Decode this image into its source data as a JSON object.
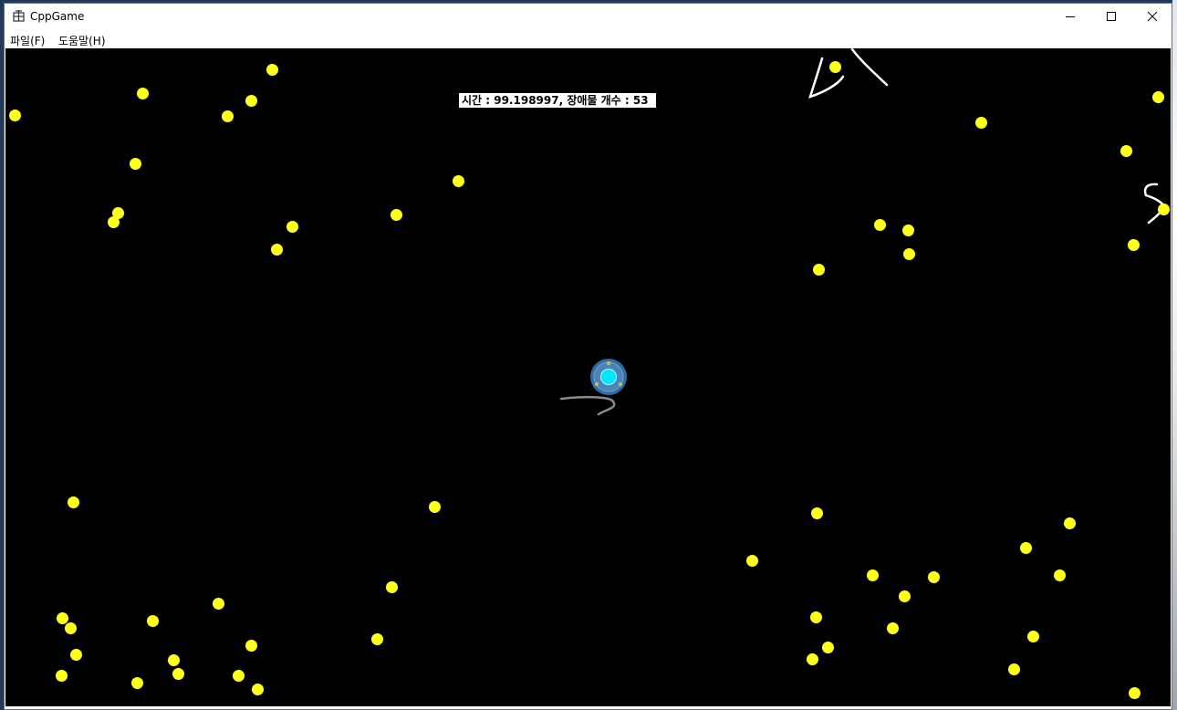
{
  "window": {
    "title": "CppGame",
    "controls": [
      "minimize",
      "maximize",
      "close"
    ]
  },
  "menu": [
    "파일(F)",
    "도움말(H)"
  ],
  "hud": {
    "text": "시간 : 99.198997, 장애물 개수 : 53"
  },
  "colors": {
    "background": "#000000",
    "obstacle": "#ffff1a",
    "player": "#00e5ff"
  },
  "icons": [
    "app-icon",
    "minimize-icon",
    "maximize-icon",
    "close-icon",
    "player-icon"
  ]
}
